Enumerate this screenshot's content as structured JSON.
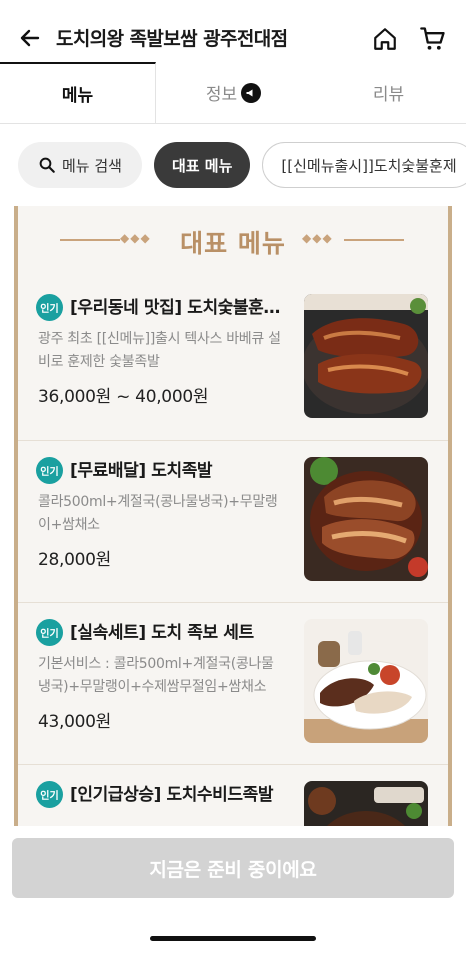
{
  "header": {
    "title": "도치의왕 족발보쌈 광주전대점",
    "back_icon": "arrow-left-icon",
    "home_icon": "home-icon",
    "cart_icon": "cart-icon"
  },
  "tabs": [
    {
      "label": "메뉴",
      "active": true
    },
    {
      "label": "정보",
      "active": false,
      "icon": "megaphone-icon"
    },
    {
      "label": "리뷰",
      "active": false
    }
  ],
  "chips": {
    "search_label": "메뉴 검색",
    "selected_label": "대표 메뉴",
    "next_label": "[[신메뉴출시]]도치숯불훈제"
  },
  "board": {
    "title": "대표 메뉴"
  },
  "popular_badge": "인기",
  "menu_items": [
    {
      "name": "[우리동네 맛집] 도치숯불훈제족발",
      "desc": "광주 최초 [[신메뉴]]출시 텍사스 바베큐 설비로 훈제한 숯불족발",
      "price": "36,000원 ~ 40,000원"
    },
    {
      "name": "[무료배달] 도치족발",
      "desc": "콜라500ml+계절국(콩나물냉국)+무말랭이+쌈채소",
      "price": "28,000원"
    },
    {
      "name": "[실속세트] 도치 족보 세트",
      "desc": "기본서비스 : 콜라500ml+계절국(콩나물냉국)+무말랭이+수제쌈무절임+쌈채소",
      "price": "43,000원"
    },
    {
      "name": "[인기급상승] 도치수비드족발",
      "desc": "",
      "price": ""
    }
  ],
  "bottom": {
    "button_label": "지금은 준비 중이에요"
  },
  "colors": {
    "badge": "#1aa0a0",
    "board_accent": "#c9ae8a",
    "board_title": "#b99066",
    "disabled_button": "#d3d3d3"
  }
}
